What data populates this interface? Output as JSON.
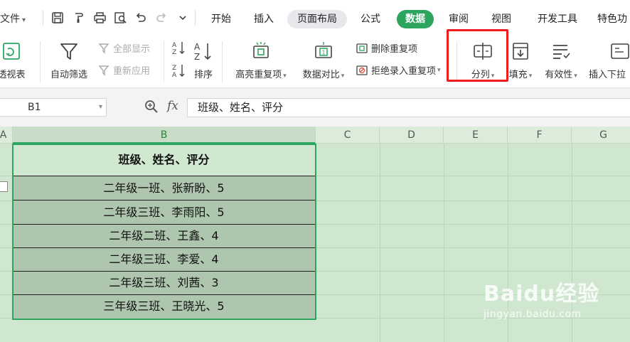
{
  "menu": {
    "file_label": "文件",
    "tabs": [
      {
        "label": "开始"
      },
      {
        "label": "插入"
      },
      {
        "label": "页面布局"
      },
      {
        "label": "公式"
      },
      {
        "label": "数据"
      },
      {
        "label": "审阅"
      },
      {
        "label": "视图"
      },
      {
        "label": "开发工具"
      },
      {
        "label": "特色功"
      }
    ],
    "active_tab": "数据"
  },
  "ribbon": {
    "pivot_label": "透视表",
    "autofilter_label": "自动筛选",
    "show_all_label": "全部显示",
    "reapply_label": "重新应用",
    "sort_label": "排序",
    "highlight_dup_label": "高亮重复项",
    "compare_label": "数据对比",
    "remove_dup_label": "删除重复项",
    "reject_dup_label": "拒绝录入重复项",
    "split_label": "分列",
    "fill_label": "填充",
    "validity_label": "有效性",
    "insert_dropdown_label": "插入下拉"
  },
  "formula_bar": {
    "name_box": "B1",
    "fx_label": "fx",
    "formula": "班级、姓名、评分"
  },
  "sheet": {
    "columns": [
      "A",
      "B",
      "C",
      "D",
      "E",
      "F",
      "G"
    ],
    "selected_column": "B",
    "header_cell": "班级、姓名、评分",
    "rows": [
      "二年级一班、张新盼、5",
      "二年级三班、李雨阳、5",
      "二年级二班、王鑫、4",
      "二年级三班、李爱、4",
      "二年级三班、刘茜、3",
      "三年级三班、王晓光、5"
    ]
  },
  "watermark": {
    "main": "Baidu经验",
    "sub": "jingyan.baidu.com"
  },
  "colors": {
    "accent": "#2ca55e",
    "highlight_box": "#ee1c1c",
    "sheet_bg": "#cfe7cf",
    "data_fill": "#aec6ae"
  }
}
